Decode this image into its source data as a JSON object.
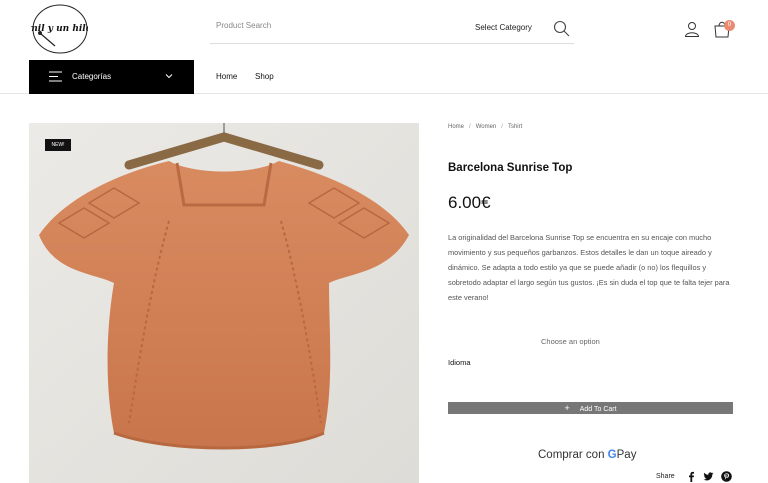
{
  "header": {
    "logo_text": "mil y un hilo",
    "search": {
      "placeholder": "Product Search",
      "category_label": "Select Category"
    },
    "cart_count": "0"
  },
  "nav": {
    "categories_label": "Categorías",
    "links": [
      "Home",
      "Shop"
    ]
  },
  "product": {
    "badge": "NEW!",
    "breadcrumb": [
      "Home",
      "Women",
      "Tshirt"
    ],
    "title": "Barcelona Sunrise Top",
    "price": "6.00€",
    "description": "La originalidad del Barcelona Sunrise Top se encuentra en su encaje con mucho movimiento y sus pequeños garbanzos. Estos detalles le dan un toque aireado y dinámico. Se adapta a todo estilo ya que se puede añadir (o no) los flequillos y sobretodo adaptar el largo según tus gustos. ¡Es sin duda el top que te falta tejer para este verano!",
    "option_placeholder": "Choose an option",
    "option_label": "Idioma",
    "add_to_cart": "Add To Cart",
    "gpay_prefix": "Comprar con",
    "gpay_g": "G",
    "gpay_suffix": "Pay",
    "share_label": "Share"
  },
  "colors": {
    "accent_badge": "#e98b73",
    "sweater": "#d9875e",
    "button": "#777777"
  },
  "icons": [
    "search-icon",
    "user-icon",
    "cart-icon",
    "menu-icon",
    "chevron-down-icon",
    "plus-icon",
    "facebook-icon",
    "twitter-icon",
    "pinterest-icon"
  ]
}
